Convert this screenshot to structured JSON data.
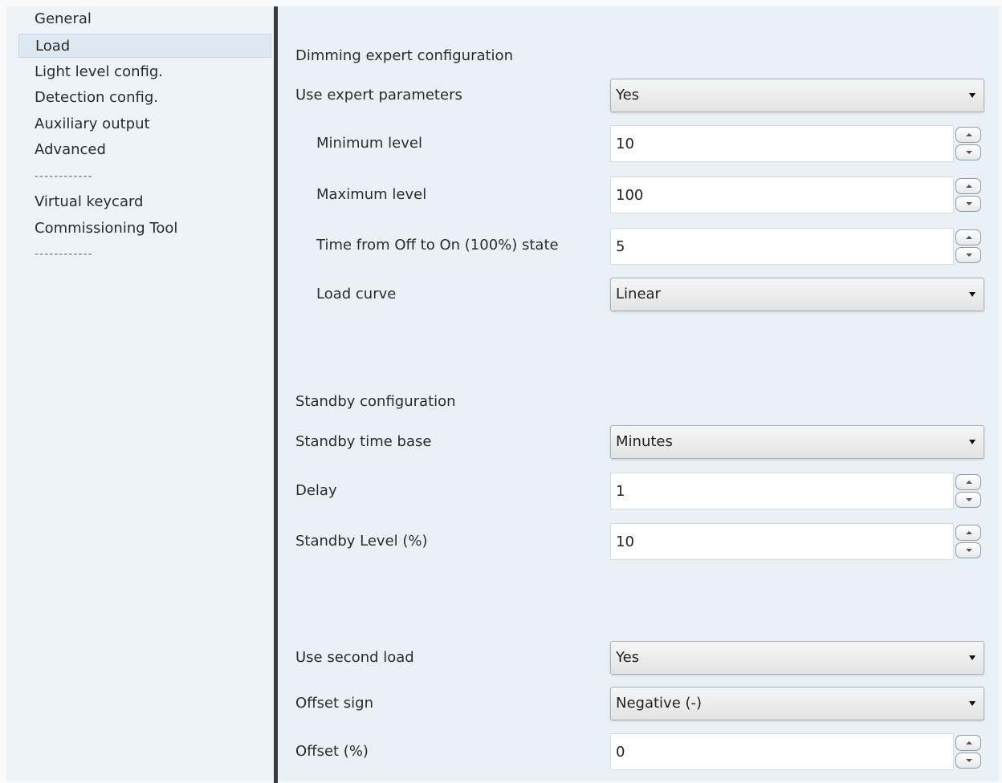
{
  "sidebar": {
    "items": [
      {
        "label": "General"
      },
      {
        "label": "Load",
        "selected": true
      },
      {
        "label": "Light level config."
      },
      {
        "label": "Detection config."
      },
      {
        "label": "Auxiliary output"
      },
      {
        "label": "Advanced"
      },
      {
        "label": "------------"
      },
      {
        "label": "Virtual keycard"
      },
      {
        "label": "Commissioning Tool"
      },
      {
        "label": "------------"
      }
    ]
  },
  "dimming": {
    "title": "Dimming expert configuration",
    "use_expert": {
      "label": "Use expert parameters",
      "value": "Yes"
    },
    "minimum_level": {
      "label": "Minimum level",
      "value": "10"
    },
    "maximum_level": {
      "label": "Maximum level",
      "value": "100"
    },
    "time_off_on": {
      "label": "Time from Off to On (100%) state",
      "value": "5"
    },
    "load_curve": {
      "label": "Load curve",
      "value": "Linear"
    }
  },
  "standby": {
    "title": "Standby configuration",
    "time_base": {
      "label": "Standby time base",
      "value": "Minutes"
    },
    "delay": {
      "label": "Delay",
      "value": "1"
    },
    "level": {
      "label": "Standby Level (%)",
      "value": "10"
    }
  },
  "second_load": {
    "use": {
      "label": "Use second load",
      "value": "Yes"
    },
    "offset_sign": {
      "label": "Offset sign",
      "value": "Negative (-)"
    },
    "offset": {
      "label": "Offset (%)",
      "value": "0"
    }
  }
}
